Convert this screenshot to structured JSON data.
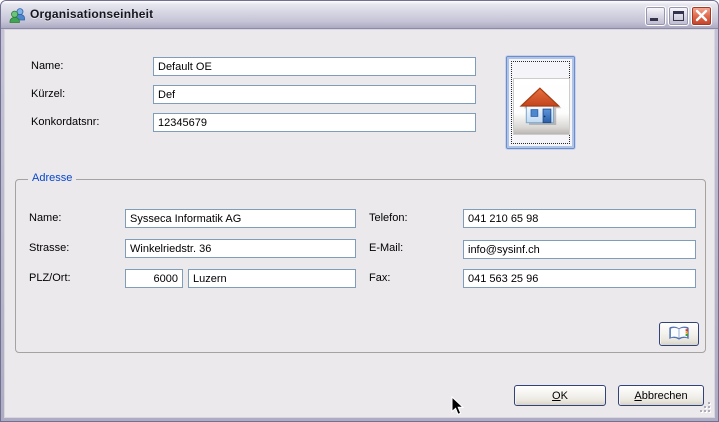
{
  "window": {
    "title": "Organisationseinheit",
    "icon": "organization-users-icon",
    "controls": {
      "minimize": "minimize",
      "maximize": "maximize",
      "close": "close"
    }
  },
  "org_form": {
    "fields": [
      {
        "label": "Name:",
        "value": "Default OE"
      },
      {
        "label": "Kürzel:",
        "value": "Def"
      },
      {
        "label": "Konkordatsnr:",
        "value": "12345679"
      }
    ],
    "logo_button_icon": "house-icon"
  },
  "address": {
    "legend": "Adresse",
    "fields_left": [
      {
        "label": "Name:",
        "value": "Sysseca Informatik AG"
      },
      {
        "label": "Strasse:",
        "value": "Winkelriedstr. 36"
      }
    ],
    "plz_ort": {
      "label": "PLZ/Ort:",
      "plz": "6000",
      "ort": "Luzern"
    },
    "fields_right": [
      {
        "label": "Telefon:",
        "value": "041 210 65 98"
      },
      {
        "label": "E-Mail:",
        "value": "info@sysinf.ch"
      },
      {
        "label": "Fax:",
        "value": "041 563 25 96"
      }
    ],
    "book_button_icon": "address-book-icon"
  },
  "footer": {
    "ok": {
      "accel": "O",
      "rest": "K"
    },
    "cancel": {
      "accel": "A",
      "rest": "bbrechen"
    }
  },
  "colors": {
    "input_border": "#7F9DB9",
    "group_title_blue": "#0747CD",
    "titlebar_silver": "#D5D4E2",
    "close_red": "#C2402A",
    "roof_orange": "#D95E2E",
    "house_blue": "#3B74C4"
  }
}
